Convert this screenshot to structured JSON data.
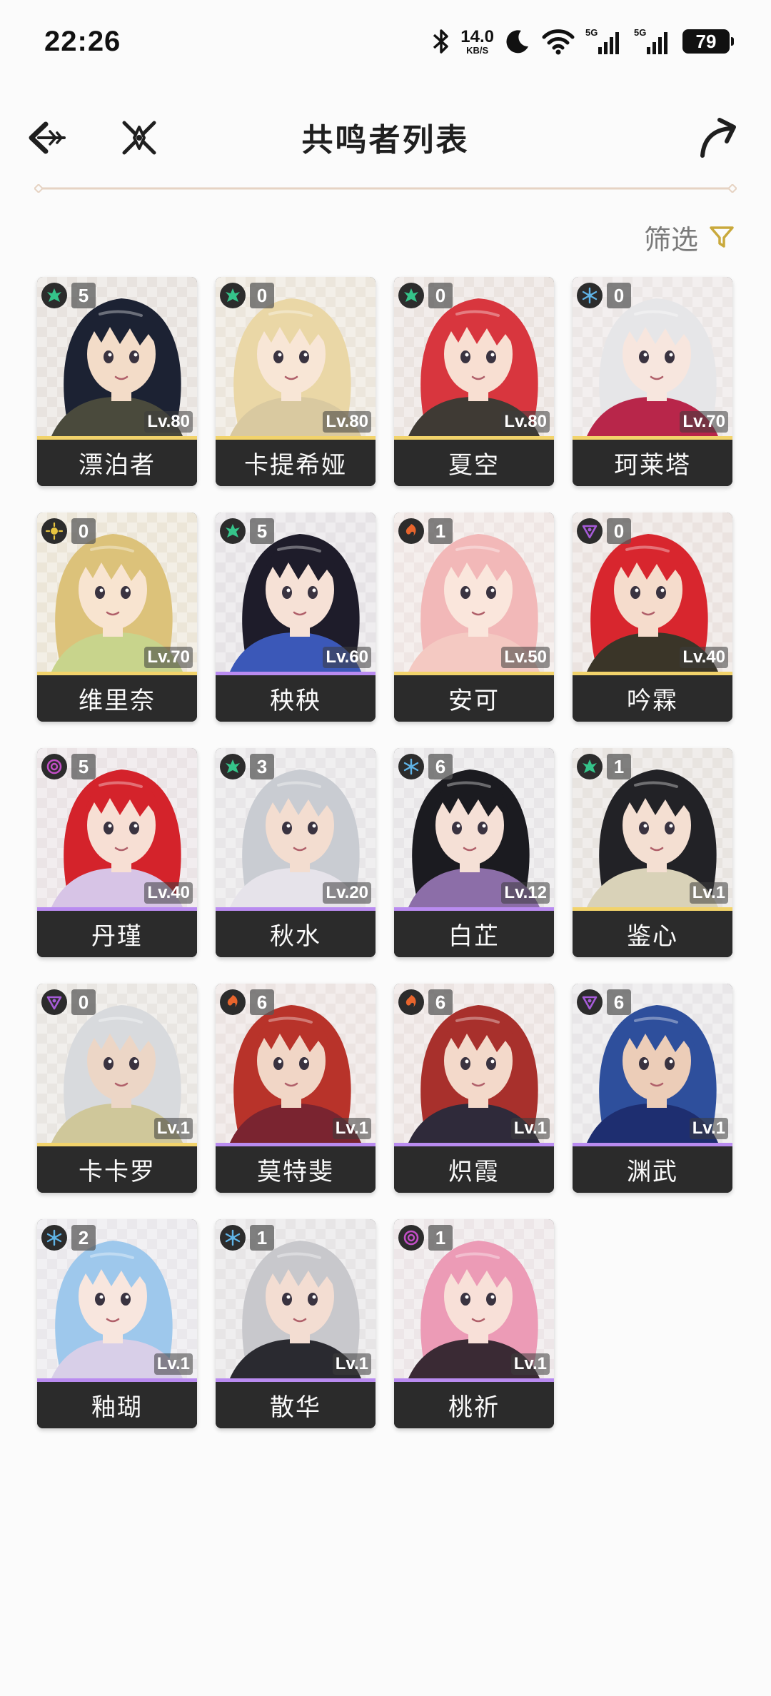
{
  "status": {
    "time": "22:26",
    "net_speed_value": "14.0",
    "net_speed_unit": "KB/S",
    "signal1_tag": "5G",
    "signal2_tag": "5G",
    "battery": "79"
  },
  "header": {
    "title": "共鸣者列表"
  },
  "filter": {
    "label": "筛选"
  },
  "colors": {
    "gold": "#f2d36b",
    "purple": "#b98bf0",
    "aero": "#35c48a",
    "glacio": "#5fb3e6",
    "fusion": "#e8652d",
    "havoc": "#a65bd8",
    "spectro": "#e8c540",
    "electro": "#c24ec6"
  },
  "characters": [
    {
      "name": "漂泊者",
      "level": "Lv.80",
      "chain": "5",
      "element": "aero",
      "rarity": "gold",
      "hair": "#1c2233",
      "skin": "#f3dcc8",
      "bg": "#e8e3df",
      "outfit": "#4a4a3c"
    },
    {
      "name": "卡提希娅",
      "level": "Lv.80",
      "chain": "0",
      "element": "aero",
      "rarity": "gold",
      "hair": "#ead7a6",
      "skin": "#f8e6d6",
      "bg": "#ece6dc",
      "outfit": "#d9c9a0"
    },
    {
      "name": "夏空",
      "level": "Lv.80",
      "chain": "0",
      "element": "aero",
      "rarity": "gold",
      "hair": "#d8363e",
      "skin": "#f8dfd2",
      "bg": "#ebe4e0",
      "outfit": "#3f3a34"
    },
    {
      "name": "珂莱塔",
      "level": "Lv.70",
      "chain": "0",
      "element": "glacio",
      "rarity": "gold",
      "hair": "#e6e6e8",
      "skin": "#f7e6de",
      "bg": "#ece7e6",
      "outfit": "#b8264a"
    },
    {
      "name": "维里奈",
      "level": "Lv.70",
      "chain": "0",
      "element": "spectro",
      "rarity": "gold",
      "hair": "#dcc27a",
      "skin": "#f8e4d0",
      "bg": "#ece6d8",
      "outfit": "#c8d48c"
    },
    {
      "name": "秧秧",
      "level": "Lv.60",
      "chain": "5",
      "element": "aero",
      "rarity": "purple",
      "hair": "#1e1c2a",
      "skin": "#f6e1d6",
      "bg": "#e6e3e6",
      "outfit": "#3b58b8"
    },
    {
      "name": "安可",
      "level": "Lv.50",
      "chain": "1",
      "element": "fusion",
      "rarity": "gold",
      "hair": "#f2b8b8",
      "skin": "#fae6dc",
      "bg": "#efe6e4",
      "outfit": "#f4c9c2"
    },
    {
      "name": "吟霖",
      "level": "Lv.40",
      "chain": "0",
      "element": "havoc",
      "rarity": "gold",
      "hair": "#d8262e",
      "skin": "#f5dccc",
      "bg": "#ebe3e0",
      "outfit": "#3a3528"
    },
    {
      "name": "丹瑾",
      "level": "Lv.40",
      "chain": "5",
      "element": "electro",
      "rarity": "purple",
      "hair": "#d4232b",
      "skin": "#f7dfd4",
      "bg": "#ebe4e6",
      "outfit": "#d7c4e6"
    },
    {
      "name": "秋水",
      "level": "Lv.20",
      "chain": "3",
      "element": "aero",
      "rarity": "purple",
      "hair": "#c9ccd2",
      "skin": "#f3ddd0",
      "bg": "#e8e6e8",
      "outfit": "#e6e3ea"
    },
    {
      "name": "白芷",
      "level": "Lv.12",
      "chain": "6",
      "element": "glacio",
      "rarity": "purple",
      "hair": "#1b1b20",
      "skin": "#f5e0d6",
      "bg": "#e8e6e8",
      "outfit": "#8c6ea8"
    },
    {
      "name": "鉴心",
      "level": "Lv.1",
      "chain": "1",
      "element": "aero",
      "rarity": "gold",
      "hair": "#222226",
      "skin": "#f4dfd2",
      "bg": "#e8e4e0",
      "outfit": "#d9d2b8"
    },
    {
      "name": "卡卡罗",
      "level": "Lv.1",
      "chain": "0",
      "element": "havoc",
      "rarity": "gold",
      "hair": "#d8dadd",
      "skin": "#ecd6c6",
      "bg": "#e9e6e2",
      "outfit": "#cfc79a"
    },
    {
      "name": "莫特斐",
      "level": "Lv.1",
      "chain": "6",
      "element": "fusion",
      "rarity": "purple",
      "hair": "#b8332a",
      "skin": "#f1d6c6",
      "bg": "#ece4e2",
      "outfit": "#7a2430"
    },
    {
      "name": "炽霞",
      "level": "Lv.1",
      "chain": "6",
      "element": "fusion",
      "rarity": "purple",
      "hair": "#a8302c",
      "skin": "#f3d9ca",
      "bg": "#ece4e2",
      "outfit": "#2f2a3a"
    },
    {
      "name": "渊武",
      "level": "Lv.1",
      "chain": "6",
      "element": "havoc",
      "rarity": "purple",
      "hair": "#2e4f9c",
      "skin": "#eccdb8",
      "bg": "#e8e6e8",
      "outfit": "#1e2e70"
    },
    {
      "name": "釉瑚",
      "level": "Lv.1",
      "chain": "2",
      "element": "glacio",
      "rarity": "purple",
      "hair": "#9ec8ec",
      "skin": "#f8e6de",
      "bg": "#eae8ec",
      "outfit": "#d8cfe8"
    },
    {
      "name": "散华",
      "level": "Lv.1",
      "chain": "1",
      "element": "glacio",
      "rarity": "purple",
      "hair": "#c8c8cc",
      "skin": "#f3ddd2",
      "bg": "#e7e5e6",
      "outfit": "#2a2a30"
    },
    {
      "name": "桃祈",
      "level": "Lv.1",
      "chain": "1",
      "element": "electro",
      "rarity": "purple",
      "hair": "#ec9bb6",
      "skin": "#f8e0d8",
      "bg": "#ede6e8",
      "outfit": "#3a2a34"
    }
  ]
}
